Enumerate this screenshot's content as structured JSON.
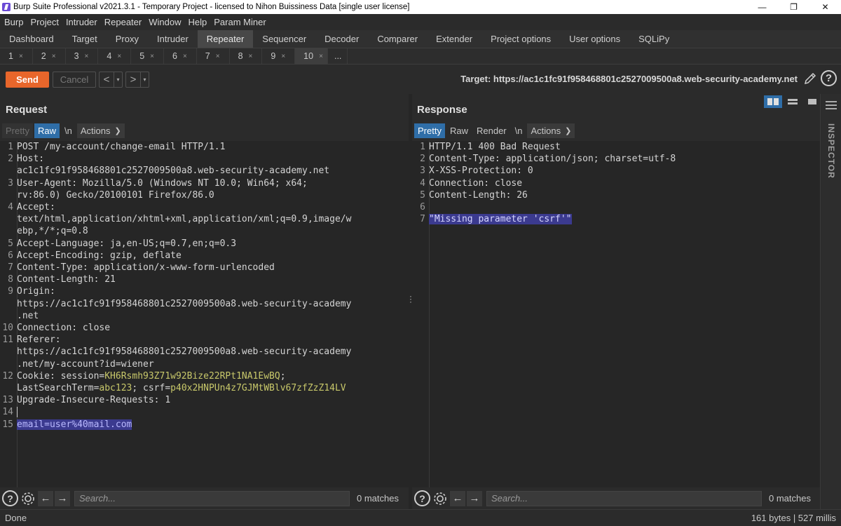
{
  "window": {
    "title": "Burp Suite Professional v2021.3.1 - Temporary Project - licensed to Nihon Buissiness Data [single user license]",
    "minimize": "—",
    "restore": "❐",
    "close": "✕"
  },
  "menu": [
    "Burp",
    "Project",
    "Intruder",
    "Repeater",
    "Window",
    "Help",
    "Param Miner"
  ],
  "main_tabs": [
    "Dashboard",
    "Target",
    "Proxy",
    "Intruder",
    "Repeater",
    "Sequencer",
    "Decoder",
    "Comparer",
    "Extender",
    "Project options",
    "User options",
    "SQLiPy"
  ],
  "active_main_tab": "Repeater",
  "sub_tabs": [
    "1",
    "2",
    "3",
    "4",
    "5",
    "6",
    "7",
    "8",
    "9",
    "10"
  ],
  "sub_tab_close": "×",
  "sub_tab_more": "...",
  "active_sub_tab": "10",
  "toolbar": {
    "send": "Send",
    "cancel": "Cancel",
    "back": "<",
    "forward": ">",
    "dropdown": "▾",
    "target": "Target: https://ac1c1fc91f958468801c2527009500a8.web-security-academy.net",
    "help": "?"
  },
  "request": {
    "title": "Request",
    "tabs": {
      "pretty": "Pretty",
      "raw": "Raw",
      "newline": "\\n",
      "actions": "Actions"
    },
    "lines": {
      "l1": "POST /my-account/change-email HTTP/1.1",
      "l2a": "Host:",
      "l2b": "ac1c1fc91f958468801c2527009500a8.web-security-academy.net",
      "l3a": "User-Agent: Mozilla/5.0 (Windows NT 10.0; Win64; x64;",
      "l3b": "rv:86.0) Gecko/20100101 Firefox/86.0",
      "l4a": "Accept:",
      "l4b": "text/html,application/xhtml+xml,application/xml;q=0.9,image/w",
      "l4c": "ebp,*/*;q=0.8",
      "l5": "Accept-Language: ja,en-US;q=0.7,en;q=0.3",
      "l6": "Accept-Encoding: gzip, deflate",
      "l7": "Content-Type: application/x-www-form-urlencoded",
      "l8": "Content-Length: 21",
      "l9a": "Origin:",
      "l9b": "https://ac1c1fc91f958468801c2527009500a8.web-security-academy",
      "l9c": ".net",
      "l10": "Connection: close",
      "l11a": "Referer:",
      "l11b": "https://ac1c1fc91f958468801c2527009500a8.web-security-academy",
      "l11c": ".net/my-account?id=wiener",
      "l12a_key": "Cookie: session=",
      "l12a_val": "KH6Rsmh93Z71w92Bize22RPt1NA1EwBQ",
      "l12a_sep": ";",
      "l12b_key": "LastSearchTerm=",
      "l12b_val": "abc123",
      "l12b_mid": "; csrf=",
      "l12b_val2": "p40x2HNPUn4z7GJMtWBlv67zfZzZ14LV",
      "l13": "Upgrade-Insecure-Requests: 1",
      "l15": "email=user%40mail.com"
    },
    "search_placeholder": "Search...",
    "matches": "0 matches"
  },
  "response": {
    "title": "Response",
    "tabs": {
      "pretty": "Pretty",
      "raw": "Raw",
      "render": "Render",
      "newline": "\\n",
      "actions": "Actions"
    },
    "lines": {
      "l1": "HTTP/1.1 400 Bad Request",
      "l2": "Content-Type: application/json; charset=utf-8",
      "l3": "X-XSS-Protection: 0",
      "l4": "Connection: close",
      "l5": "Content-Length: 26",
      "l7": "\"Missing parameter 'csrf'\""
    },
    "search_placeholder": "Search...",
    "matches": "0 matches"
  },
  "inspector_label": "INSPECTOR",
  "status": {
    "left": "Done",
    "right": "161 bytes | 527 millis"
  }
}
